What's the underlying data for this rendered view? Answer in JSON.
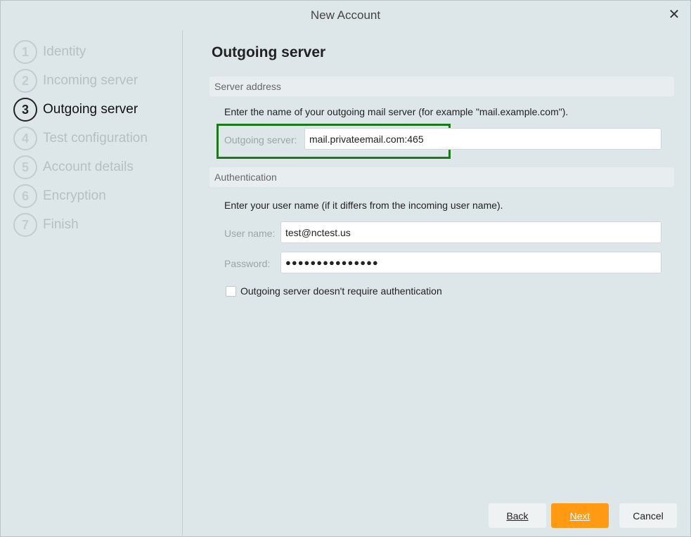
{
  "window": {
    "title": "New Account",
    "close_glyph": "✕"
  },
  "steps": [
    {
      "num": "1",
      "label": "Identity",
      "active": false
    },
    {
      "num": "2",
      "label": "Incoming server",
      "active": false
    },
    {
      "num": "3",
      "label": "Outgoing server",
      "active": true
    },
    {
      "num": "4",
      "label": "Test configuration",
      "active": false
    },
    {
      "num": "5",
      "label": "Account details",
      "active": false
    },
    {
      "num": "6",
      "label": "Encryption",
      "active": false
    },
    {
      "num": "7",
      "label": "Finish",
      "active": false
    }
  ],
  "page": {
    "title": "Outgoing server",
    "server_section": {
      "header": "Server address",
      "description": "Enter the name of your outgoing mail server (for example \"mail.example.com\").",
      "label": "Outgoing server:",
      "value": "mail.privateemail.com:465"
    },
    "auth_section": {
      "header": "Authentication",
      "description": "Enter your user name (if it differs from the incoming user name).",
      "username_label": "User name:",
      "username_value": "test@nctest.us",
      "password_label": "Password:",
      "password_value": "●●●●●●●●●●●●●●●"
    },
    "no_auth_checkbox": {
      "label": "Outgoing server doesn't require authentication",
      "checked": false
    }
  },
  "buttons": {
    "back": "Back",
    "next": "Next",
    "cancel": "Cancel"
  },
  "colors": {
    "accent": "#ff9a12",
    "highlight": "#1a7a1a",
    "background": "#dde7ea"
  }
}
